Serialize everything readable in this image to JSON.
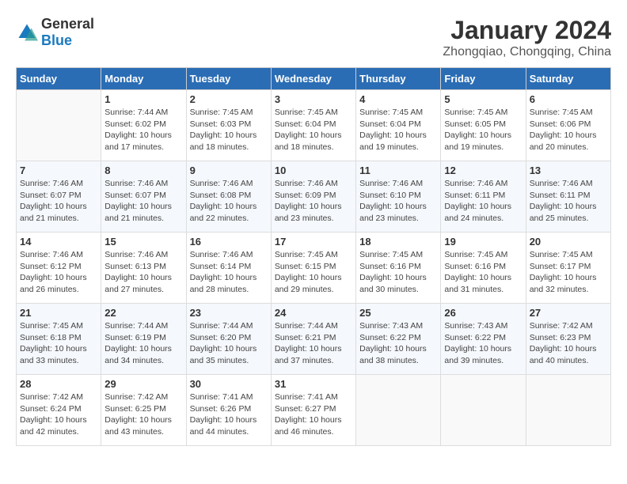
{
  "logo": {
    "general": "General",
    "blue": "Blue"
  },
  "title": "January 2024",
  "location": "Zhongqiao, Chongqing, China",
  "days_of_week": [
    "Sunday",
    "Monday",
    "Tuesday",
    "Wednesday",
    "Thursday",
    "Friday",
    "Saturday"
  ],
  "weeks": [
    [
      {
        "day": "",
        "info": ""
      },
      {
        "day": "1",
        "info": "Sunrise: 7:44 AM\nSunset: 6:02 PM\nDaylight: 10 hours\nand 17 minutes."
      },
      {
        "day": "2",
        "info": "Sunrise: 7:45 AM\nSunset: 6:03 PM\nDaylight: 10 hours\nand 18 minutes."
      },
      {
        "day": "3",
        "info": "Sunrise: 7:45 AM\nSunset: 6:04 PM\nDaylight: 10 hours\nand 18 minutes."
      },
      {
        "day": "4",
        "info": "Sunrise: 7:45 AM\nSunset: 6:04 PM\nDaylight: 10 hours\nand 19 minutes."
      },
      {
        "day": "5",
        "info": "Sunrise: 7:45 AM\nSunset: 6:05 PM\nDaylight: 10 hours\nand 19 minutes."
      },
      {
        "day": "6",
        "info": "Sunrise: 7:45 AM\nSunset: 6:06 PM\nDaylight: 10 hours\nand 20 minutes."
      }
    ],
    [
      {
        "day": "7",
        "info": "Sunrise: 7:46 AM\nSunset: 6:07 PM\nDaylight: 10 hours\nand 21 minutes."
      },
      {
        "day": "8",
        "info": "Sunrise: 7:46 AM\nSunset: 6:07 PM\nDaylight: 10 hours\nand 21 minutes."
      },
      {
        "day": "9",
        "info": "Sunrise: 7:46 AM\nSunset: 6:08 PM\nDaylight: 10 hours\nand 22 minutes."
      },
      {
        "day": "10",
        "info": "Sunrise: 7:46 AM\nSunset: 6:09 PM\nDaylight: 10 hours\nand 23 minutes."
      },
      {
        "day": "11",
        "info": "Sunrise: 7:46 AM\nSunset: 6:10 PM\nDaylight: 10 hours\nand 23 minutes."
      },
      {
        "day": "12",
        "info": "Sunrise: 7:46 AM\nSunset: 6:11 PM\nDaylight: 10 hours\nand 24 minutes."
      },
      {
        "day": "13",
        "info": "Sunrise: 7:46 AM\nSunset: 6:11 PM\nDaylight: 10 hours\nand 25 minutes."
      }
    ],
    [
      {
        "day": "14",
        "info": "Sunrise: 7:46 AM\nSunset: 6:12 PM\nDaylight: 10 hours\nand 26 minutes."
      },
      {
        "day": "15",
        "info": "Sunrise: 7:46 AM\nSunset: 6:13 PM\nDaylight: 10 hours\nand 27 minutes."
      },
      {
        "day": "16",
        "info": "Sunrise: 7:46 AM\nSunset: 6:14 PM\nDaylight: 10 hours\nand 28 minutes."
      },
      {
        "day": "17",
        "info": "Sunrise: 7:45 AM\nSunset: 6:15 PM\nDaylight: 10 hours\nand 29 minutes."
      },
      {
        "day": "18",
        "info": "Sunrise: 7:45 AM\nSunset: 6:16 PM\nDaylight: 10 hours\nand 30 minutes."
      },
      {
        "day": "19",
        "info": "Sunrise: 7:45 AM\nSunset: 6:16 PM\nDaylight: 10 hours\nand 31 minutes."
      },
      {
        "day": "20",
        "info": "Sunrise: 7:45 AM\nSunset: 6:17 PM\nDaylight: 10 hours\nand 32 minutes."
      }
    ],
    [
      {
        "day": "21",
        "info": "Sunrise: 7:45 AM\nSunset: 6:18 PM\nDaylight: 10 hours\nand 33 minutes."
      },
      {
        "day": "22",
        "info": "Sunrise: 7:44 AM\nSunset: 6:19 PM\nDaylight: 10 hours\nand 34 minutes."
      },
      {
        "day": "23",
        "info": "Sunrise: 7:44 AM\nSunset: 6:20 PM\nDaylight: 10 hours\nand 35 minutes."
      },
      {
        "day": "24",
        "info": "Sunrise: 7:44 AM\nSunset: 6:21 PM\nDaylight: 10 hours\nand 37 minutes."
      },
      {
        "day": "25",
        "info": "Sunrise: 7:43 AM\nSunset: 6:22 PM\nDaylight: 10 hours\nand 38 minutes."
      },
      {
        "day": "26",
        "info": "Sunrise: 7:43 AM\nSunset: 6:22 PM\nDaylight: 10 hours\nand 39 minutes."
      },
      {
        "day": "27",
        "info": "Sunrise: 7:42 AM\nSunset: 6:23 PM\nDaylight: 10 hours\nand 40 minutes."
      }
    ],
    [
      {
        "day": "28",
        "info": "Sunrise: 7:42 AM\nSunset: 6:24 PM\nDaylight: 10 hours\nand 42 minutes."
      },
      {
        "day": "29",
        "info": "Sunrise: 7:42 AM\nSunset: 6:25 PM\nDaylight: 10 hours\nand 43 minutes."
      },
      {
        "day": "30",
        "info": "Sunrise: 7:41 AM\nSunset: 6:26 PM\nDaylight: 10 hours\nand 44 minutes."
      },
      {
        "day": "31",
        "info": "Sunrise: 7:41 AM\nSunset: 6:27 PM\nDaylight: 10 hours\nand 46 minutes."
      },
      {
        "day": "",
        "info": ""
      },
      {
        "day": "",
        "info": ""
      },
      {
        "day": "",
        "info": ""
      }
    ]
  ]
}
